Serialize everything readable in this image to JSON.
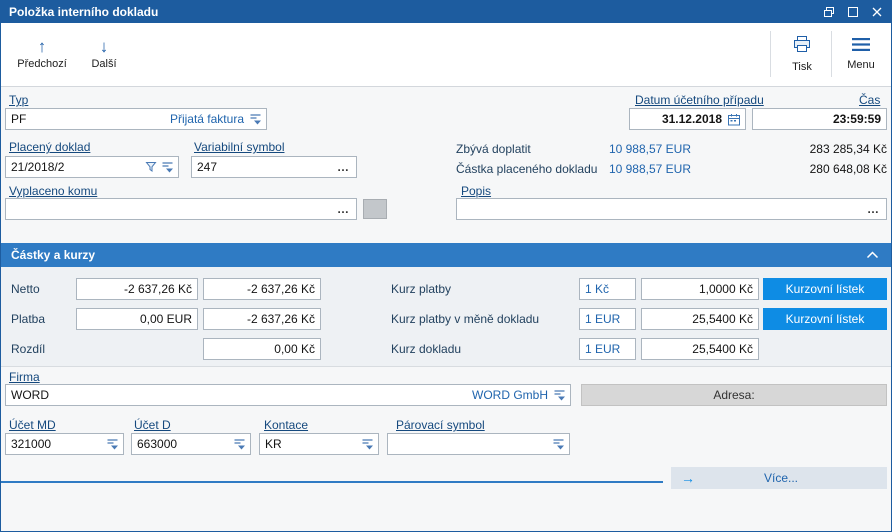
{
  "colors": {
    "titlebar": "#1d5c9f",
    "section_header": "#2f7bc4",
    "primary_button": "#0e8ce4",
    "label_link": "#15497e",
    "value_blue": "#1f64ad"
  },
  "icons": {
    "up": "↑",
    "down": "↓",
    "more_arrow": "→"
  },
  "window": {
    "title": "Položka interního dokladu"
  },
  "toolbar": {
    "previous": "Předchozí",
    "next": "Další",
    "print": "Tisk",
    "menu": "Menu"
  },
  "header_fields": {
    "typ_label": "Typ",
    "typ_code": "PF",
    "typ_name": "Přijatá faktura",
    "datum_label": "Datum účetního případu",
    "datum_value": "31.12.2018",
    "cas_label": "Čas",
    "cas_value": "23:59:59",
    "placeny_doklad_label": "Placený doklad",
    "placeny_doklad_value": "21/2018/2",
    "variabilni_symbol_label": "Variabilní symbol",
    "variabilni_symbol_value": "247",
    "zbyva_doplatit_label": "Zbývá doplatit",
    "zbyva_doplatit_eur": "10 988,57 EUR",
    "zbyva_doplatit_czk": "283 285,34 Kč",
    "castka_label": "Částka placeného dokladu",
    "castka_eur": "10 988,57 EUR",
    "castka_czk": "280 648,08 Kč",
    "vyplaceno_komu_label": "Vyplaceno komu",
    "vyplaceno_komu_value": "",
    "popis_label": "Popis",
    "popis_value": "",
    "ellipsis": "…"
  },
  "amounts_section": {
    "title": "Částky a kurzy",
    "netto_label": "Netto",
    "netto_v1": "-2 637,26 Kč",
    "netto_v2": "-2 637,26 Kč",
    "platba_label": "Platba",
    "platba_v1": "0,00 EUR",
    "platba_v2": "-2 637,26 Kč",
    "rozdil_label": "Rozdíl",
    "rozdil_v2": "0,00 Kč",
    "kurz_platby_label": "Kurz platby",
    "kurz_platby_unit": "1 Kč",
    "kurz_platby_rate": "1,0000 Kč",
    "kurz_mena_label": "Kurz platby v měně dokladu",
    "kurz_mena_unit": "1 EUR",
    "kurz_mena_rate": "25,5400 Kč",
    "kurz_dokladu_label": "Kurz dokladu",
    "kurz_dokladu_unit": "1 EUR",
    "kurz_dokladu_rate": "25,5400 Kč",
    "kurzovni_listek": "Kurzovní lístek"
  },
  "firma": {
    "label": "Firma",
    "code": "WORD",
    "name": "WORD GmbH",
    "adresa_label": "Adresa:"
  },
  "accounts": {
    "ucet_md_label": "Účet MD",
    "ucet_md_value": "321000",
    "ucet_d_label": "Účet D",
    "ucet_d_value": "663000",
    "kontace_label": "Kontace",
    "kontace_value": "KR",
    "parovaci_label": "Párovací symbol",
    "parovaci_value": ""
  },
  "footer": {
    "more": "Více..."
  }
}
